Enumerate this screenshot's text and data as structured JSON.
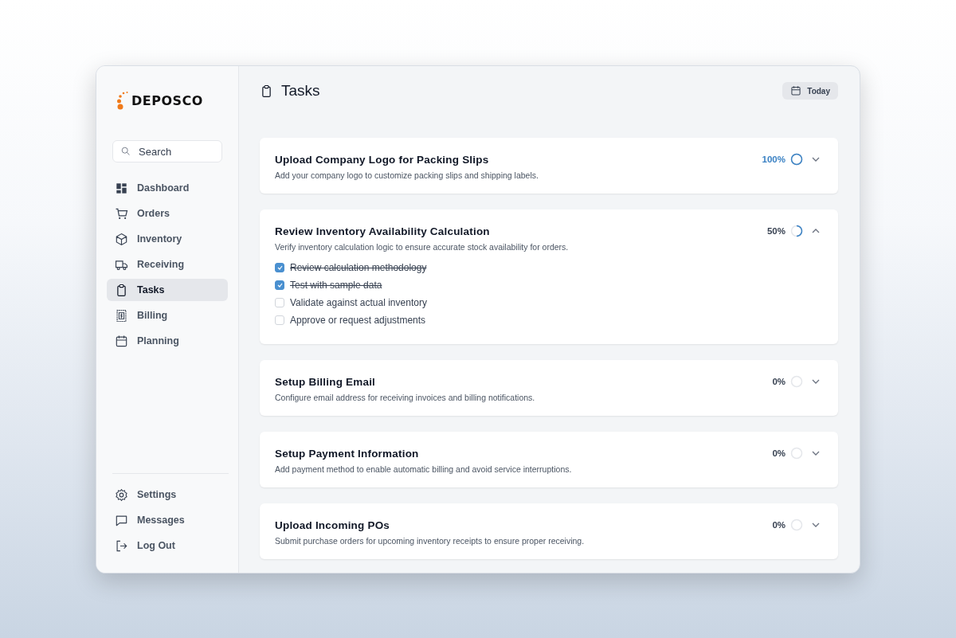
{
  "sidebar": {
    "brand": "DEPOSCO",
    "search": {
      "placeholder": "Search"
    },
    "items": [
      {
        "label": "Dashboard",
        "selected": false
      },
      {
        "label": "Orders",
        "selected": false
      },
      {
        "label": "Inventory",
        "selected": false
      },
      {
        "label": "Receiving",
        "selected": false
      },
      {
        "label": "Tasks",
        "selected": true
      },
      {
        "label": "Billing",
        "selected": false
      },
      {
        "label": "Planning",
        "selected": false
      }
    ],
    "footer_items": [
      {
        "label": "Settings"
      },
      {
        "label": "Messages"
      },
      {
        "label": "Log Out"
      }
    ]
  },
  "header": {
    "title": "Tasks",
    "date_button": "Today"
  },
  "tasks": [
    {
      "title": "Upload Company Logo for Packing Slips",
      "description": "Add your company logo to customize packing slips and shipping labels.",
      "percent": "100%",
      "level": 1,
      "expanded": false
    },
    {
      "title": "Review Inventory Availability Calculation",
      "description": "Verify inventory calculation logic to ensure accurate stock availability for orders.",
      "percent": "50%",
      "level": 0.5,
      "expanded": true,
      "subtasks": [
        {
          "label": "Review calculation methodology",
          "checked": true
        },
        {
          "label": "Test with sample data",
          "checked": true
        },
        {
          "label": "Validate against actual inventory",
          "checked": false
        },
        {
          "label": "Approve or request adjustments",
          "checked": false
        }
      ]
    },
    {
      "title": "Setup Billing Email",
      "description": "Configure email address for receiving invoices and billing notifications.",
      "percent": "0%",
      "expanded": false
    },
    {
      "title": "Setup Payment Information",
      "description": "Add payment method to enable automatic billing and avoid service interruptions.",
      "percent": "0%",
      "expanded": false
    },
    {
      "title": "Upload Incoming POs",
      "description": "Submit purchase orders for upcoming inventory receipts to ensure proper receiving.",
      "percent": "0%",
      "expanded": false
    }
  ]
}
